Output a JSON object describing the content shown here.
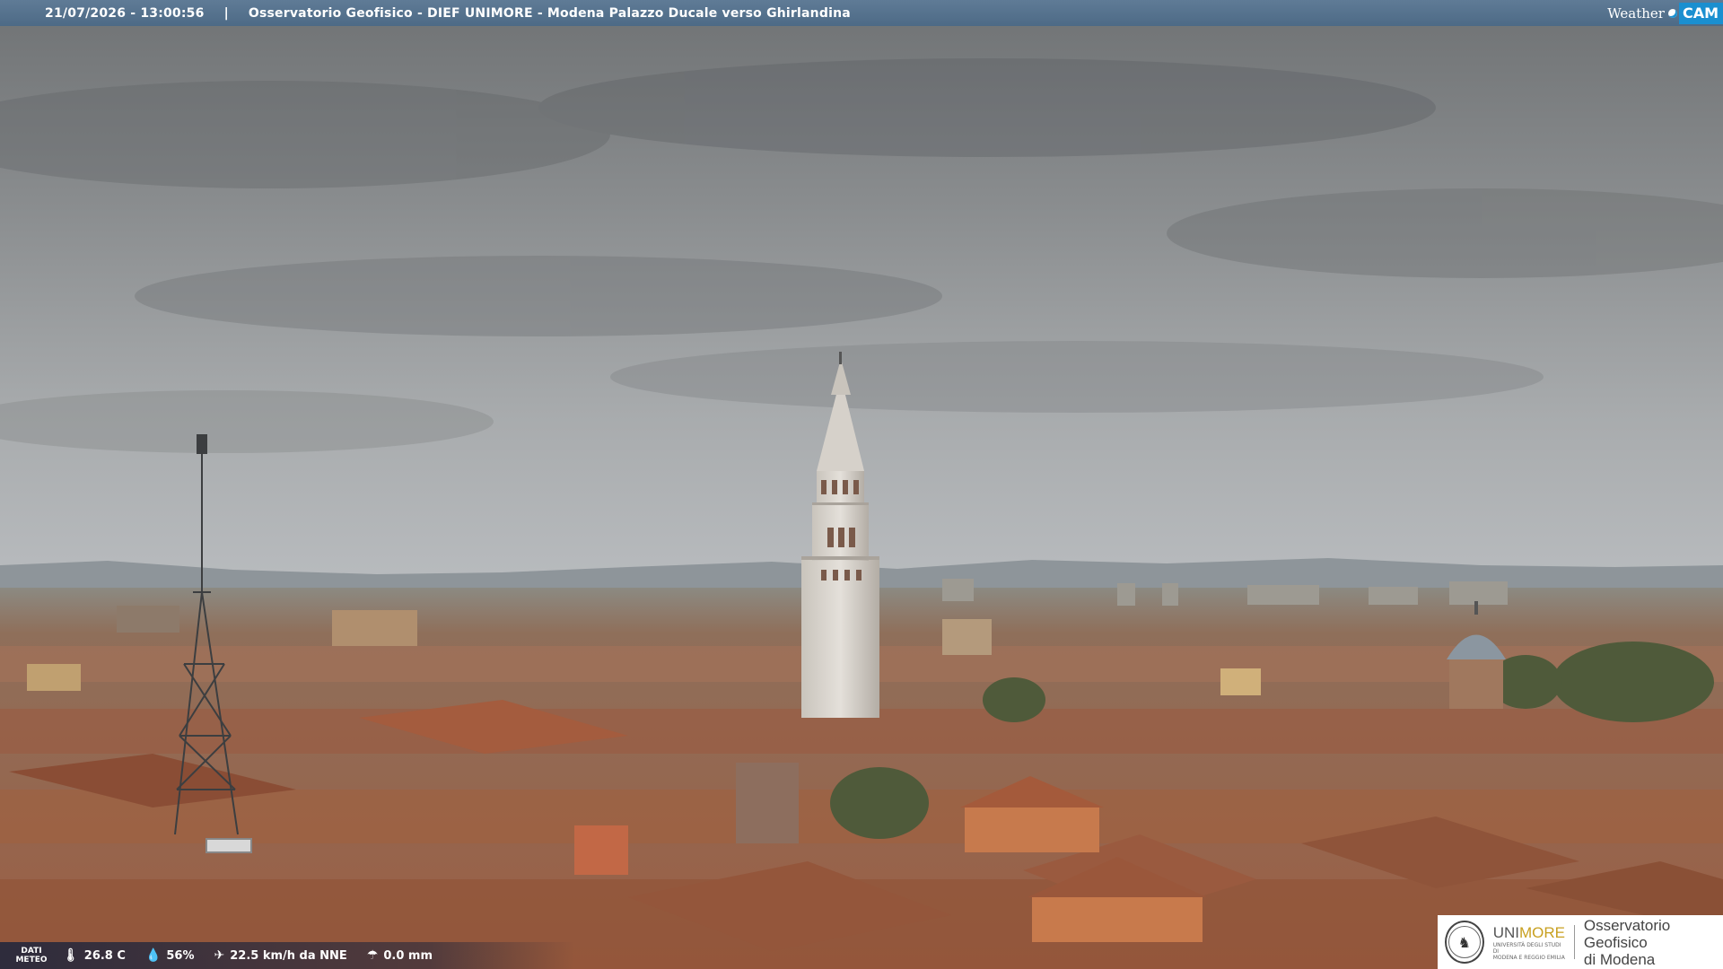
{
  "header": {
    "timestamp": "21/07/2026 - 13:00:56",
    "separator": "|",
    "title": "Osservatorio Geofisico - DIEF UNIMORE - Modena Palazzo Ducale verso Ghirlandina"
  },
  "logo": {
    "weather": "Weather",
    "cam": "CAM",
    "icon": "weathercam-dot-icon"
  },
  "meteo": {
    "label_line1": "DATI",
    "label_line2": "METEO",
    "temperature": "26.8 C",
    "humidity": "56%",
    "wind": "22.5 km/h da NNE",
    "rain": "0.0 mm",
    "icons": {
      "temperature": "thermometer-icon",
      "humidity": "drop-icon",
      "wind": "wind-icon",
      "rain": "rain-icon"
    }
  },
  "unimore": {
    "brand_uni": "UNI",
    "brand_more": "MORE",
    "subtitle_line1": "UNIVERSITÀ DEGLI STUDI DI",
    "subtitle_line2": "MODENA E REGGIO EMILIA",
    "observatory_line1": "Osservatorio Geofisico",
    "observatory_line2": "di Modena"
  },
  "colors": {
    "topbar": "#55728e",
    "weathercam_blue": "#1a8fd0",
    "unimore_gold": "#c8a020",
    "sky": "#a9abad",
    "roofs": "#a2664a"
  }
}
